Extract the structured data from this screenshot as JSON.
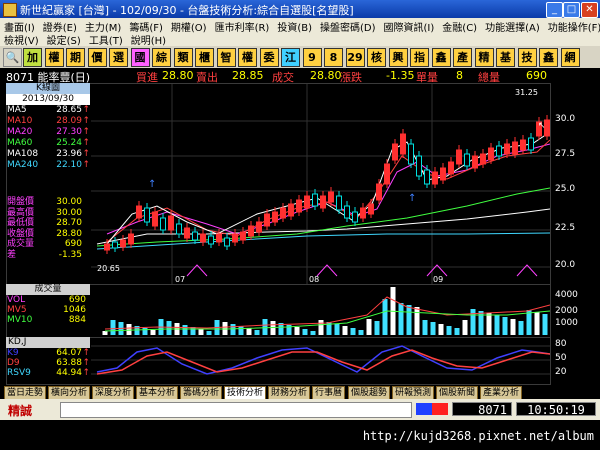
{
  "window": {
    "title": "新世紀贏家 [台灣] - 102/09/30 - 台盤技術分析:綜合自選股[名望股]"
  },
  "menu": {
    "row1": [
      "畫面(I)",
      "證券(E)",
      "主力(M)",
      "籌碼(F)",
      "期權(O)",
      "匯市利率(R)",
      "投資(B)",
      "操盤密碼(D)",
      "國際資訊(I)",
      "金融(C)",
      "功能選擇(A)",
      "功能操作(F)"
    ],
    "row2": [
      "檢視(V)",
      "設定(S)",
      "工具(T)",
      "說明(H)"
    ]
  },
  "toolbar": {
    "buttons": [
      "加",
      "權",
      "期",
      "價",
      "選",
      "國",
      "綜",
      "類",
      "櫃",
      "智",
      "權",
      "委",
      "江",
      "9",
      "8",
      "29",
      "核",
      "興",
      "指",
      "鑫",
      "產",
      "精",
      "基",
      "技",
      "鑫",
      "網"
    ]
  },
  "quote": {
    "code_name": "8071 能率豐(日)",
    "buy_label": "買進",
    "buy_value": "28.80",
    "sell_label": "賣出",
    "sell_value": "28.85",
    "deal_label": "成交",
    "deal_value": "28.80",
    "change_label": "漲跌",
    "change_value": "-1.35",
    "single_label": "單量",
    "single_value": "8",
    "total_label": "總量",
    "total_value": "690"
  },
  "legend": {
    "header": "K線圖",
    "date": "2013/09/30",
    "rows": [
      {
        "name": "MA5",
        "value": "28.65",
        "arrow": "↑",
        "color": "#ffffff"
      },
      {
        "name": "MA10",
        "value": "28.09",
        "arrow": "↑",
        "color": "#ff4040"
      },
      {
        "name": "MA20",
        "value": "27.30",
        "arrow": "↑",
        "color": "#ff40ff"
      },
      {
        "name": "MA60",
        "value": "25.24",
        "arrow": "↑",
        "color": "#40ff40"
      },
      {
        "name": "MA108",
        "value": "23.96",
        "arrow": "↑",
        "color": "#ffffff"
      },
      {
        "name": "MA240",
        "value": "22.10",
        "arrow": "↑",
        "color": "#40d8ff"
      }
    ],
    "price_rows": [
      {
        "name": "開盤價",
        "value": "30.00"
      },
      {
        "name": "最高價",
        "value": "30.00"
      },
      {
        "name": "最低價",
        "value": "28.70"
      },
      {
        "name": "收盤價",
        "value": "28.80"
      },
      {
        "name": "成交量",
        "value": "690"
      },
      {
        "name": "差",
        "value": "-1.35"
      }
    ]
  },
  "price_chart": {
    "y_ticks": [
      "30.0",
      "27.5",
      "25.0",
      "22.5",
      "20.0"
    ],
    "high_label": "31.25",
    "low_label": "20.65",
    "x_labels": [
      "07",
      "08",
      "09"
    ]
  },
  "volume_panel": {
    "header": "成交量",
    "rows": [
      {
        "name": "VOL",
        "value": "690",
        "color": "#ff40ff"
      },
      {
        "name": "MV5",
        "value": "1046",
        "color": "#ff4040"
      },
      {
        "name": "MV10",
        "value": "884",
        "color": "#40ff40"
      }
    ],
    "y_ticks": [
      "4000",
      "2000",
      "1000"
    ]
  },
  "kd_panel": {
    "header": "KD,J",
    "rows": [
      {
        "name": "K9",
        "value": "64.07",
        "arrow": "↑",
        "color": "#4040ff"
      },
      {
        "name": "D9",
        "value": "63.88",
        "arrow": "↑",
        "color": "#ff4040"
      },
      {
        "name": "RSV9",
        "value": "44.94",
        "arrow": "↑",
        "color": "#40d8ff"
      }
    ],
    "y_ticks": [
      "80",
      "50",
      "20"
    ]
  },
  "tabs": [
    "當日走勢",
    "橫向分析",
    "深度分析",
    "基本分析",
    "籌碼分析",
    "技術分析",
    "財務分析",
    "行事曆",
    "個股趨勢",
    "研報預測",
    "個股新聞",
    "產業分析"
  ],
  "active_tab_index": 5,
  "status": {
    "left_label": "精誠",
    "code": "8071",
    "time": "10:50:19"
  },
  "url_text": "http://kujd3268.pixnet.net/album",
  "colors": {
    "up": "#ff3030",
    "down": "#00e0e0",
    "accent": "#ffff00"
  }
}
